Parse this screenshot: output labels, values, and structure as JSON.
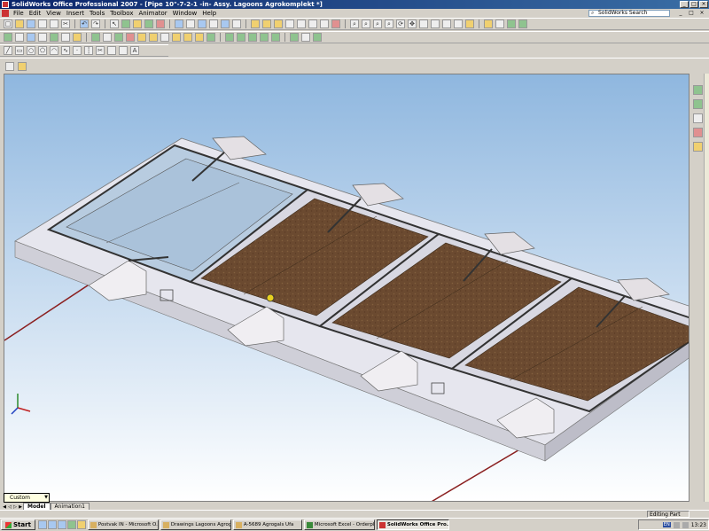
{
  "window": {
    "title": "SolidWorks Office Professional 2007 - [Pipe 10\"-7-2-1 -in- Assy. Lagoons Agrokomplekt *]",
    "minimize": "_",
    "maximize": "□",
    "close": "×"
  },
  "menu": {
    "items": [
      "File",
      "Edit",
      "View",
      "Insert",
      "Tools",
      "Toolbox",
      "Animator",
      "Window",
      "Help"
    ],
    "search_placeholder": "SolidWorks Search",
    "doc_controls": [
      "_",
      "□",
      "×"
    ]
  },
  "view_dropdown": "Custom",
  "tabs": [
    "Model",
    "Animation1"
  ],
  "status": "Editing Part",
  "taskbar": {
    "start": "Start",
    "buttons": [
      "Postvak IN - Microsoft O...",
      "Drawings Lagoons Agrog...",
      "A-5689 Agrogals Ufa",
      "Microsoft Excel - Orderpl...",
      "SolidWorks Office Pro..."
    ],
    "lang": "EN",
    "clock": "13:23"
  },
  "colors": {
    "soil": "#6b4a30",
    "concrete": "#e6e6ee",
    "water": "#b8cce0",
    "pipe": "#8b2020",
    "titlebar": "#0a246a"
  }
}
